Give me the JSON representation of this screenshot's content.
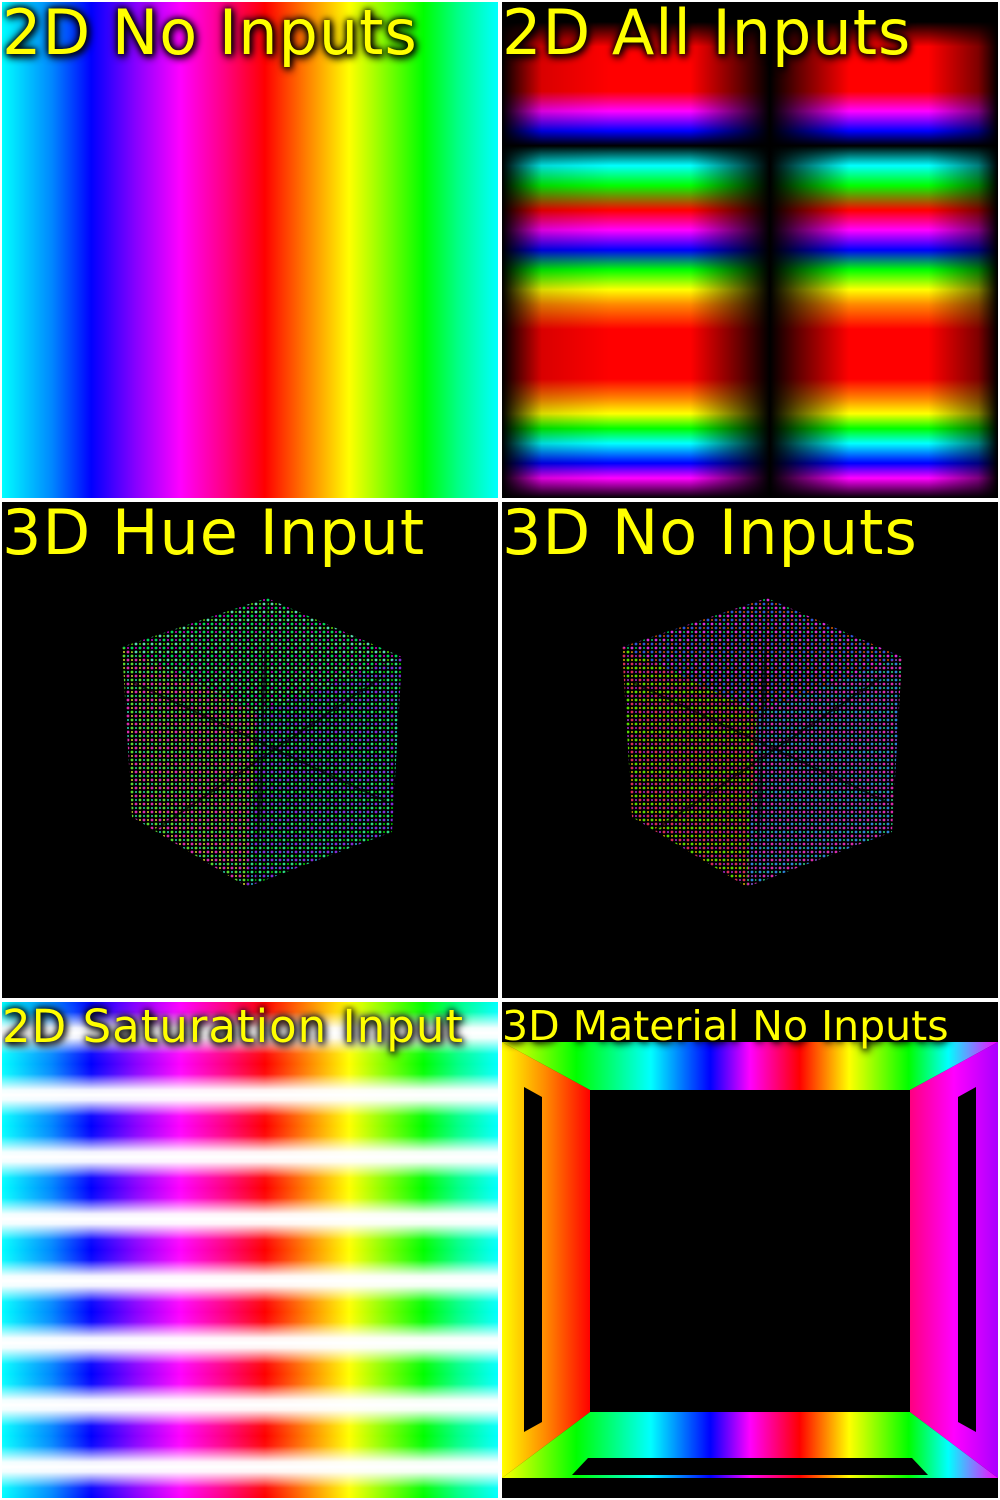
{
  "panels": [
    {
      "title": "2D No Inputs"
    },
    {
      "title": "2D All Inputs"
    },
    {
      "title": "3D Hue Input"
    },
    {
      "title": "3D No Inputs"
    },
    {
      "title": "2D Saturation Input"
    },
    {
      "title": "3D Material No Inputs"
    }
  ],
  "colors": {
    "label": "#ffff00",
    "background": "#000000",
    "separator": "#ffffff"
  }
}
